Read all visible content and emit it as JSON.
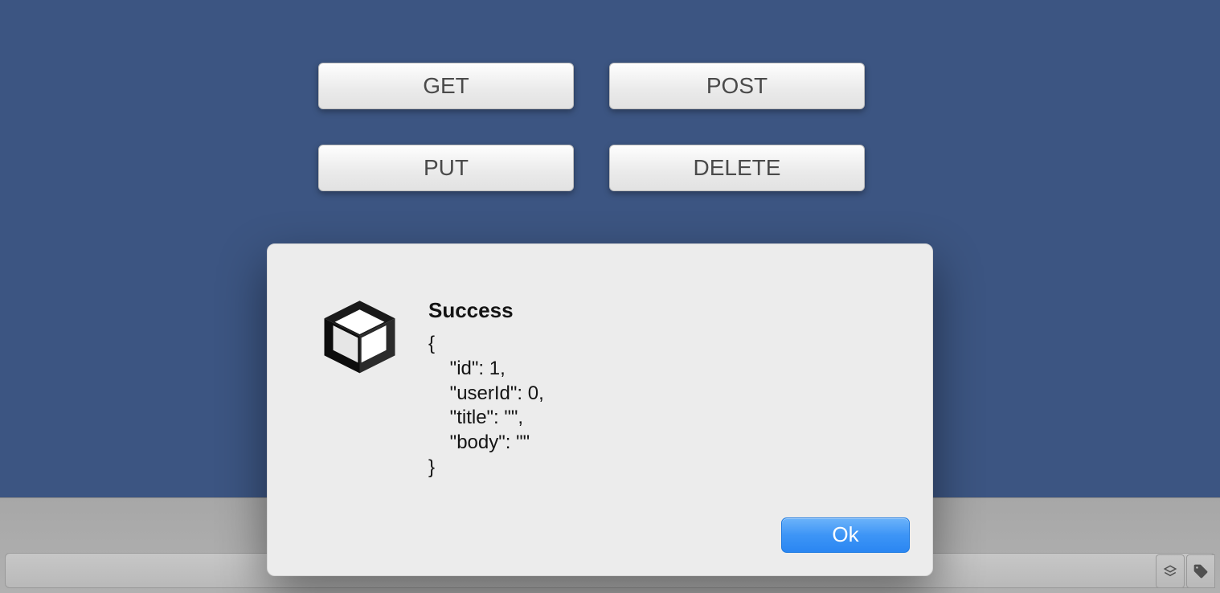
{
  "buttons": {
    "get": "GET",
    "post": "POST",
    "put": "PUT",
    "delete": "DELETE"
  },
  "dialog": {
    "title": "Success",
    "body": "{\n    \"id\": 1,\n    \"userId\": 0,\n    \"title\": \"\",\n    \"body\": \"\"\n}",
    "ok_label": "Ok"
  }
}
